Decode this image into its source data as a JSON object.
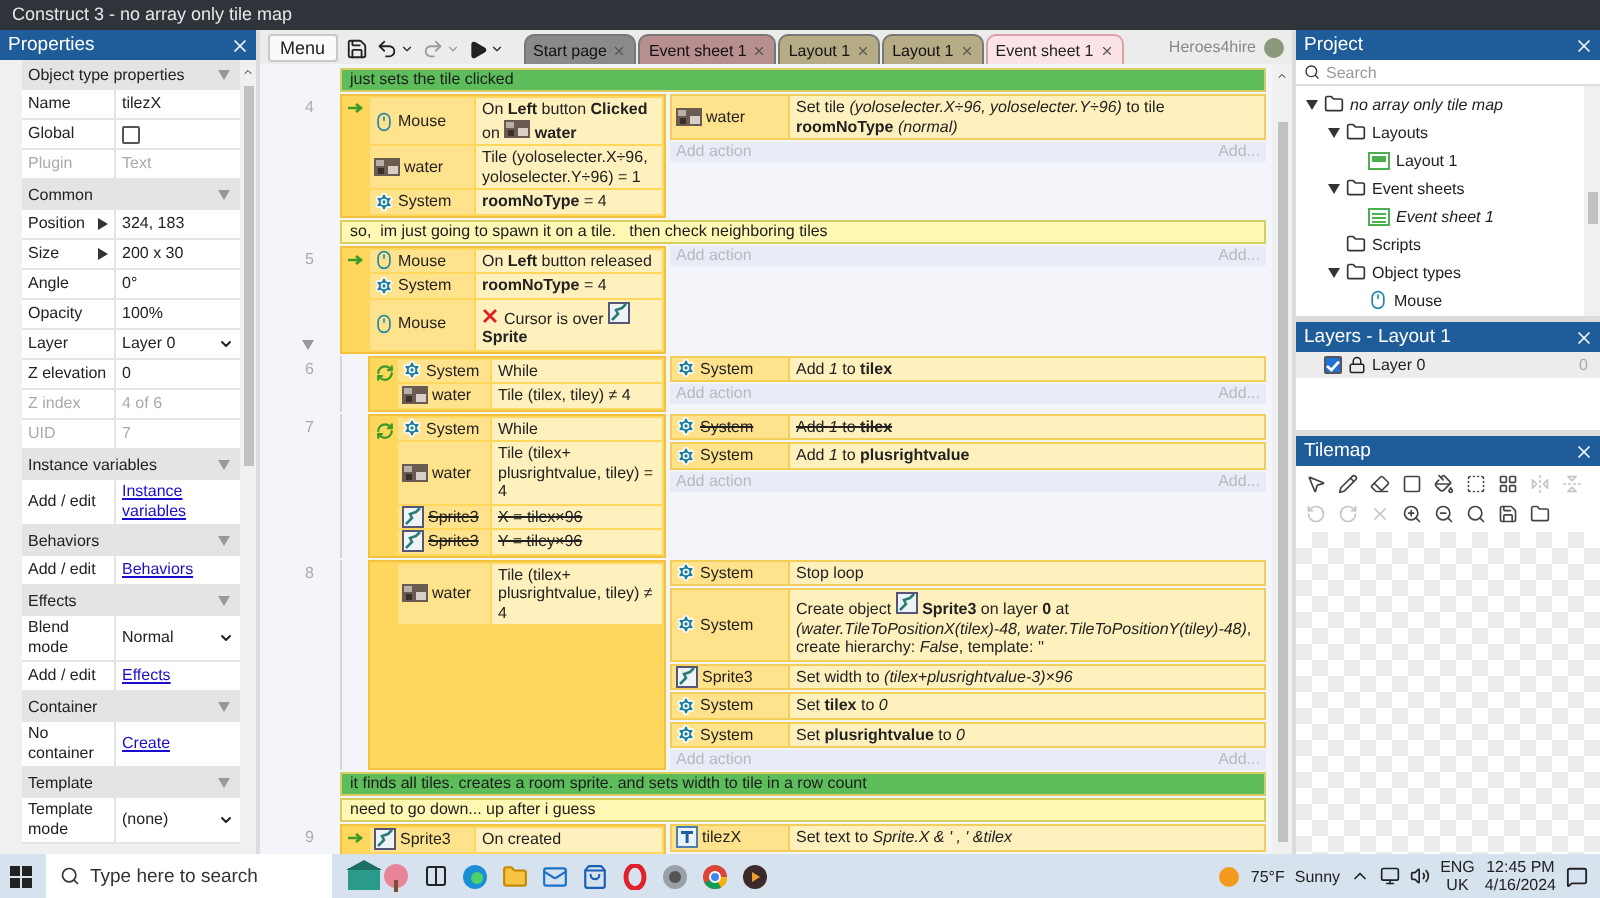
{
  "window": {
    "title": "Construct 3 - no array only tile map"
  },
  "properties": {
    "title": "Properties",
    "sections": [
      {
        "title": "Object type properties",
        "expanded": true,
        "rows": [
          {
            "kind": "text",
            "label": "Name",
            "value": "tilezX",
            "disabled": false
          },
          {
            "kind": "checkbox",
            "label": "Global",
            "checked": false,
            "disabled": false
          },
          {
            "kind": "text",
            "label": "Plugin",
            "value": "Text",
            "disabled": true
          }
        ]
      },
      {
        "title": "Common",
        "expanded": true,
        "rows": [
          {
            "kind": "expander",
            "label": "Position",
            "value": "324, 183",
            "disabled": false
          },
          {
            "kind": "expander",
            "label": "Size",
            "value": "200 x 30",
            "disabled": false
          },
          {
            "kind": "text",
            "label": "Angle",
            "value": "0°",
            "disabled": false
          },
          {
            "kind": "text",
            "label": "Opacity",
            "value": "100%",
            "disabled": false
          },
          {
            "kind": "dropdown",
            "label": "Layer",
            "value": "Layer 0",
            "disabled": false
          },
          {
            "kind": "text",
            "label": "Z elevation",
            "value": "0",
            "disabled": false
          },
          {
            "kind": "text",
            "label": "Z index",
            "value": "4 of 6",
            "disabled": true
          },
          {
            "kind": "text",
            "label": "UID",
            "value": "7",
            "disabled": true
          }
        ]
      },
      {
        "title": "Instance variables",
        "expanded": true,
        "rows": [
          {
            "kind": "link",
            "label": "Add / edit",
            "value": "Instance variables",
            "disabled": false
          }
        ]
      },
      {
        "title": "Behaviors",
        "expanded": true,
        "rows": [
          {
            "kind": "link",
            "label": "Add / edit",
            "value": "Behaviors",
            "disabled": false
          }
        ]
      },
      {
        "title": "Effects",
        "expanded": true,
        "rows": [
          {
            "kind": "dropdown",
            "label": "Blend mode",
            "value": "Normal",
            "disabled": false
          },
          {
            "kind": "link",
            "label": "Add / edit",
            "value": "Effects",
            "disabled": false
          }
        ]
      },
      {
        "title": "Container",
        "expanded": true,
        "rows": [
          {
            "kind": "link",
            "label": "No container",
            "value": "Create",
            "disabled": false
          }
        ]
      },
      {
        "title": "Template",
        "expanded": true,
        "rows": [
          {
            "kind": "dropdown",
            "label": "Template mode",
            "value": "(none)",
            "disabled": false
          }
        ]
      }
    ]
  },
  "toolbar": {
    "menu": "Menu",
    "user": "Heroes4hire"
  },
  "tabs": [
    {
      "label": "Start page",
      "selected": false,
      "color": "#8a8a8a"
    },
    {
      "label": "Event sheet 1",
      "selected": false,
      "color": "#b78f8f"
    },
    {
      "label": "Layout 1",
      "selected": false,
      "color": "#b5ac86"
    },
    {
      "label": "Layout 1",
      "selected": false,
      "color": "#b5ac86"
    },
    {
      "label": "Event sheet 1",
      "selected": true,
      "color": "#fbe3e6"
    }
  ],
  "sheet": [
    {
      "kind": "comment",
      "text": "just sets the tile clicked",
      "color": "#5cbd5a"
    },
    {
      "kind": "trigger-event",
      "number": "4",
      "add_action": "Add action",
      "add_more": "Add...",
      "conditions": [
        {
          "object": "Mouse",
          "kind": "mouse",
          "text": "On **Left** button **Clicked** on",
          "target": {
            "name": "water",
            "kind": "tilemap"
          },
          "negated": false,
          "disabled": false
        },
        {
          "object": "water",
          "kind": "tilemap",
          "text": "Tile (yoloselecter.X÷96, yoloselecter.Y÷96) = 1",
          "negated": false,
          "disabled": false
        },
        {
          "object": "System",
          "kind": "system",
          "text": "**roomNoType** = 4",
          "negated": false,
          "disabled": false
        }
      ],
      "actions": [
        {
          "object": "water",
          "kind": "tilemap",
          "text": "Set tile *(yoloselecter.X÷96, yoloselecter.Y÷96)* to tile **roomNoType** *(normal)*",
          "disabled": false
        }
      ]
    },
    {
      "kind": "comment",
      "text": "so,  im just going to spawn it on a tile.   then check neighboring tiles",
      "color": "#fff8b4"
    },
    {
      "kind": "trigger-event",
      "number": "5",
      "expanded": true,
      "add_action": "Add action",
      "add_more": "Add...",
      "conditions": [
        {
          "object": "Mouse",
          "kind": "mouse",
          "text": "On **Left** button released",
          "negated": false,
          "disabled": false
        },
        {
          "object": "System",
          "kind": "system",
          "text": "**roomNoType** = 4",
          "negated": false,
          "disabled": false
        },
        {
          "object": "Mouse",
          "kind": "mouse",
          "text": "Cursor is over",
          "target": {
            "name": "Sprite",
            "kind": "sprite"
          },
          "negated": true,
          "disabled": false
        }
      ],
      "children": [
        {
          "kind": "loop-event",
          "number": "6",
          "add_action": "Add action",
          "add_more": "Add...",
          "conditions": [
            {
              "object": "System",
              "kind": "system",
              "text": "While",
              "negated": false,
              "disabled": false
            },
            {
              "object": "water",
              "kind": "tilemap",
              "text": "Tile (tilex, tiley) ≠ 4",
              "negated": false,
              "disabled": false
            }
          ],
          "actions": [
            {
              "object": "System",
              "kind": "system",
              "text": "Add *1* to **tilex**",
              "disabled": false
            }
          ]
        },
        {
          "kind": "loop-event",
          "number": "7",
          "add_action": "Add action",
          "add_more": "Add...",
          "conditions": [
            {
              "object": "System",
              "kind": "system",
              "text": "While",
              "negated": false,
              "disabled": false
            },
            {
              "object": "water",
              "kind": "tilemap",
              "text": "Tile (tilex+ plusrightvalue, tiley) = 4",
              "negated": false,
              "disabled": false
            },
            {
              "object": "Sprite3",
              "kind": "sprite",
              "text": "X = tilex×96",
              "negated": false,
              "disabled": true
            },
            {
              "object": "Sprite3",
              "kind": "sprite",
              "text": "Y = tiley×96",
              "negated": false,
              "disabled": true
            }
          ],
          "actions": [
            {
              "object": "System",
              "kind": "system",
              "text": "Add *1* to **tilex**",
              "disabled": true
            },
            {
              "object": "System",
              "kind": "system",
              "text": "Add *1* to **plusrightvalue**",
              "disabled": false
            }
          ]
        },
        {
          "kind": "event",
          "number": "8",
          "add_action": "Add action",
          "add_more": "Add...",
          "conditions": [
            {
              "object": "water",
              "kind": "tilemap",
              "text": "Tile (tilex+ plusrightvalue, tiley) ≠ 4",
              "negated": false,
              "disabled": false
            }
          ],
          "actions": [
            {
              "object": "System",
              "kind": "system",
              "text": "Stop loop",
              "disabled": false
            },
            {
              "object": "System",
              "kind": "system",
              "text": "Create object",
              "target": {
                "name": "Sprite3",
                "kind": "sprite"
              },
              "after": "on layer **0** at *(water.TileToPositionX(tilex)-48, water.TileToPositionY(tiley)-48)*, create hierarchy: *False*, template: ''",
              "disabled": false
            },
            {
              "object": "Sprite3",
              "kind": "sprite",
              "text": "Set width to *(tilex+plusrightvalue-3)×96*",
              "disabled": false
            },
            {
              "object": "System",
              "kind": "system",
              "text": "Set **tilex** to *0*",
              "disabled": false
            },
            {
              "object": "System",
              "kind": "system",
              "text": "Set **plusrightvalue** to *0*",
              "disabled": false
            }
          ]
        }
      ]
    },
    {
      "kind": "comment",
      "text": "it finds all tiles. creates a room sprite. and sets width to tile in a row count",
      "color": "#5cbd5a"
    },
    {
      "kind": "comment",
      "text": "need to go down... up after i guess",
      "color": "#fff8b4"
    },
    {
      "kind": "trigger-event",
      "number": "9",
      "conditions": [
        {
          "object": "Sprite3",
          "kind": "sprite",
          "text": "On created",
          "negated": false,
          "disabled": false
        }
      ],
      "actions": [
        {
          "object": "tilezX",
          "kind": "text",
          "text": "Set text to *Sprite.X & ' , ' &tilex*",
          "disabled": false
        }
      ]
    }
  ],
  "project": {
    "title": "Project",
    "search_placeholder": "Search",
    "tree": [
      {
        "kind": "root",
        "label": "no array only tile map",
        "expanded": true,
        "children": [
          {
            "kind": "folder",
            "label": "Layouts",
            "expanded": true,
            "children": [
              {
                "kind": "layout",
                "label": "Layout 1"
              }
            ]
          },
          {
            "kind": "folder",
            "label": "Event sheets",
            "expanded": true,
            "children": [
              {
                "kind": "eventsheet",
                "label": "Event sheet 1"
              }
            ]
          },
          {
            "kind": "folder",
            "label": "Scripts"
          },
          {
            "kind": "folder",
            "label": "Object types",
            "expanded": true,
            "children": [
              {
                "kind": "mouse",
                "label": "Mouse"
              }
            ]
          }
        ]
      }
    ]
  },
  "layers": {
    "title": "Layers - Layout 1",
    "items": [
      {
        "name": "Layer 0",
        "checked": true,
        "locked": true,
        "count": "0"
      }
    ]
  },
  "tilemap": {
    "title": "Tilemap",
    "tools": [
      {
        "disabled": false
      },
      {
        "disabled": false
      },
      {
        "disabled": false
      },
      {
        "disabled": false
      },
      {
        "disabled": false
      },
      {
        "disabled": false
      },
      {
        "disabled": false
      },
      {
        "disabled": true
      },
      {
        "disabled": true
      },
      {
        "disabled": true
      },
      {
        "disabled": true
      },
      {
        "disabled": true
      },
      {
        "disabled": false
      },
      {
        "disabled": false
      },
      {
        "disabled": false
      },
      {
        "disabled": false
      },
      {
        "disabled": false
      }
    ]
  },
  "taskbar": {
    "search_placeholder": "Type here to search",
    "temperature": "75°F",
    "weather": "Sunny",
    "language": "ENG",
    "region": "UK",
    "time": "12:45 PM",
    "date": "4/16/2024"
  }
}
